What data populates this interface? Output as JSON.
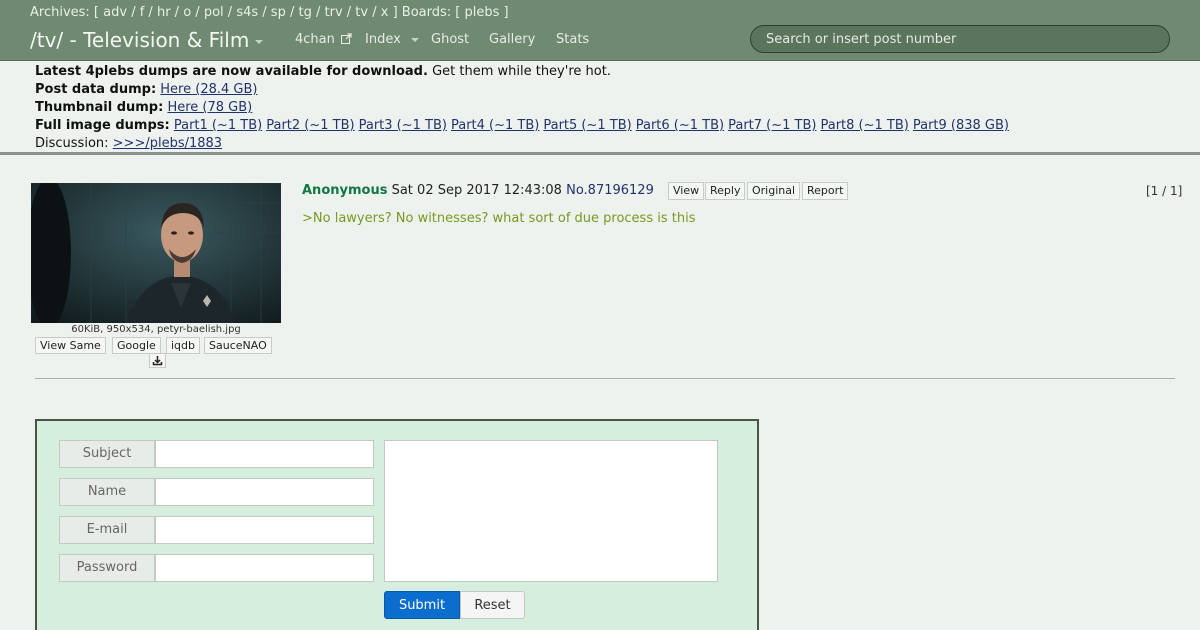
{
  "header": {
    "archives_label": "Archives:",
    "archives": [
      "adv",
      "f",
      "hr",
      "o",
      "pol",
      "s4s",
      "sp",
      "tg",
      "trv",
      "tv",
      "x"
    ],
    "boards_label": "Boards:",
    "boards": [
      "plebs"
    ],
    "title": "/tv/ - Television & Film",
    "nav": {
      "fourchan": "4chan",
      "index": "Index",
      "ghost": "Ghost",
      "gallery": "Gallery",
      "stats": "Stats"
    },
    "search_placeholder": "Search or insert post number"
  },
  "notice": {
    "headline_bold": "Latest 4plebs dumps are now available for download.",
    "headline_rest": "Get them while they're hot.",
    "post_dump_label": "Post data dump:",
    "post_dump_link": "Here (28.4 GB)",
    "thumb_dump_label": "Thumbnail dump:",
    "thumb_dump_link": "Here (78 GB)",
    "full_dump_label": "Full image dumps:",
    "full_dump_parts": [
      "Part1 (~1 TB)",
      "Part2 (~1 TB)",
      "Part3 (~1 TB)",
      "Part4 (~1 TB)",
      "Part5 (~1 TB)",
      "Part6 (~1 TB)",
      "Part7 (~1 TB)",
      "Part8 (~1 TB)",
      "Part9 (838 GB)"
    ],
    "discussion_label": "Discussion:",
    "discussion_link": ">>>/plebs/1883"
  },
  "post": {
    "file_info": "60KiB, 950x534, petyr-baelish.jpg",
    "image_buttons": {
      "view_same": "View Same",
      "google": "Google",
      "iqdb": "iqdb",
      "saucenao": "SauceNAO"
    },
    "name": "Anonymous",
    "date": "Sat 02 Sep 2017 12:43:08",
    "number": "No.87196129",
    "buttons": {
      "view": "View",
      "reply": "Reply",
      "original": "Original",
      "report": "Report"
    },
    "counter": "[1 / 1]",
    "comment": ">No lawyers? No witnesses? what sort of due process is this"
  },
  "form": {
    "subject_label": "Subject",
    "name_label": "Name",
    "email_label": "E-mail",
    "password_label": "Password",
    "subject_value": "",
    "name_value": "",
    "email_value": "",
    "password_value": "",
    "comment_value": "",
    "submit_label": "Submit",
    "reset_label": "Reset"
  },
  "colors": {
    "header_bg": "#6f8a70",
    "page_bg": "#eef2ee",
    "form_bg": "#d6eedd",
    "poster_name": "#117743",
    "greentext": "#789922",
    "submit_bg": "#0b6dcd"
  },
  "icons": {
    "external_link": "external-link-icon",
    "download": "download-icon",
    "dropdown": "chevron-down-icon"
  }
}
